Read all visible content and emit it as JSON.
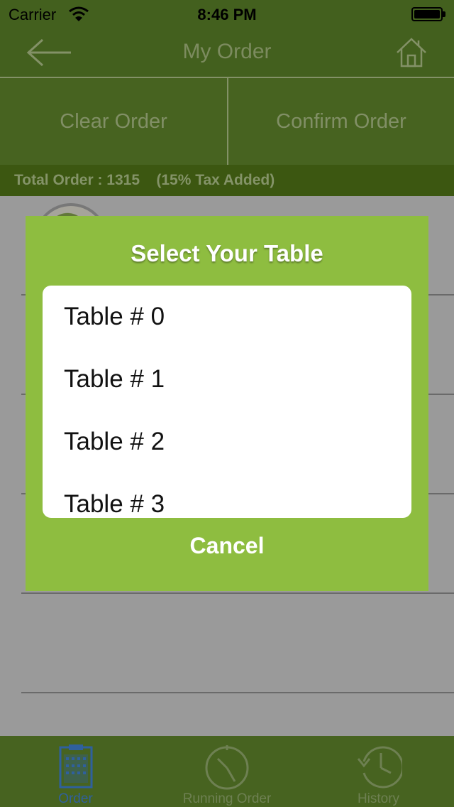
{
  "status_bar": {
    "carrier": "Carrier",
    "time": "8:46 PM",
    "battery_level": 1.0
  },
  "nav": {
    "title": "My Order",
    "back_icon": "back-arrow-icon",
    "home_icon": "home-icon"
  },
  "actions": {
    "clear_label": "Clear Order",
    "confirm_label": "Confirm Order"
  },
  "summary": {
    "total_label": "Total Order : 1315    (15% Tax Added)"
  },
  "modal": {
    "title": "Select Your Table",
    "options": [
      "Table # 0",
      "Table # 1",
      "Table # 2",
      "Table # 3"
    ],
    "cancel_label": "Cancel"
  },
  "tabs": [
    {
      "label": "Order",
      "icon": "clipboard-icon",
      "selected": true
    },
    {
      "label": "Running Order",
      "icon": "timer-icon",
      "selected": false
    },
    {
      "label": "History",
      "icon": "history-clock-icon",
      "selected": false
    }
  ],
  "colors": {
    "nav_green": "#577b27",
    "modal_green": "#8ebd40",
    "tab_selected": "#3d7cc9"
  }
}
